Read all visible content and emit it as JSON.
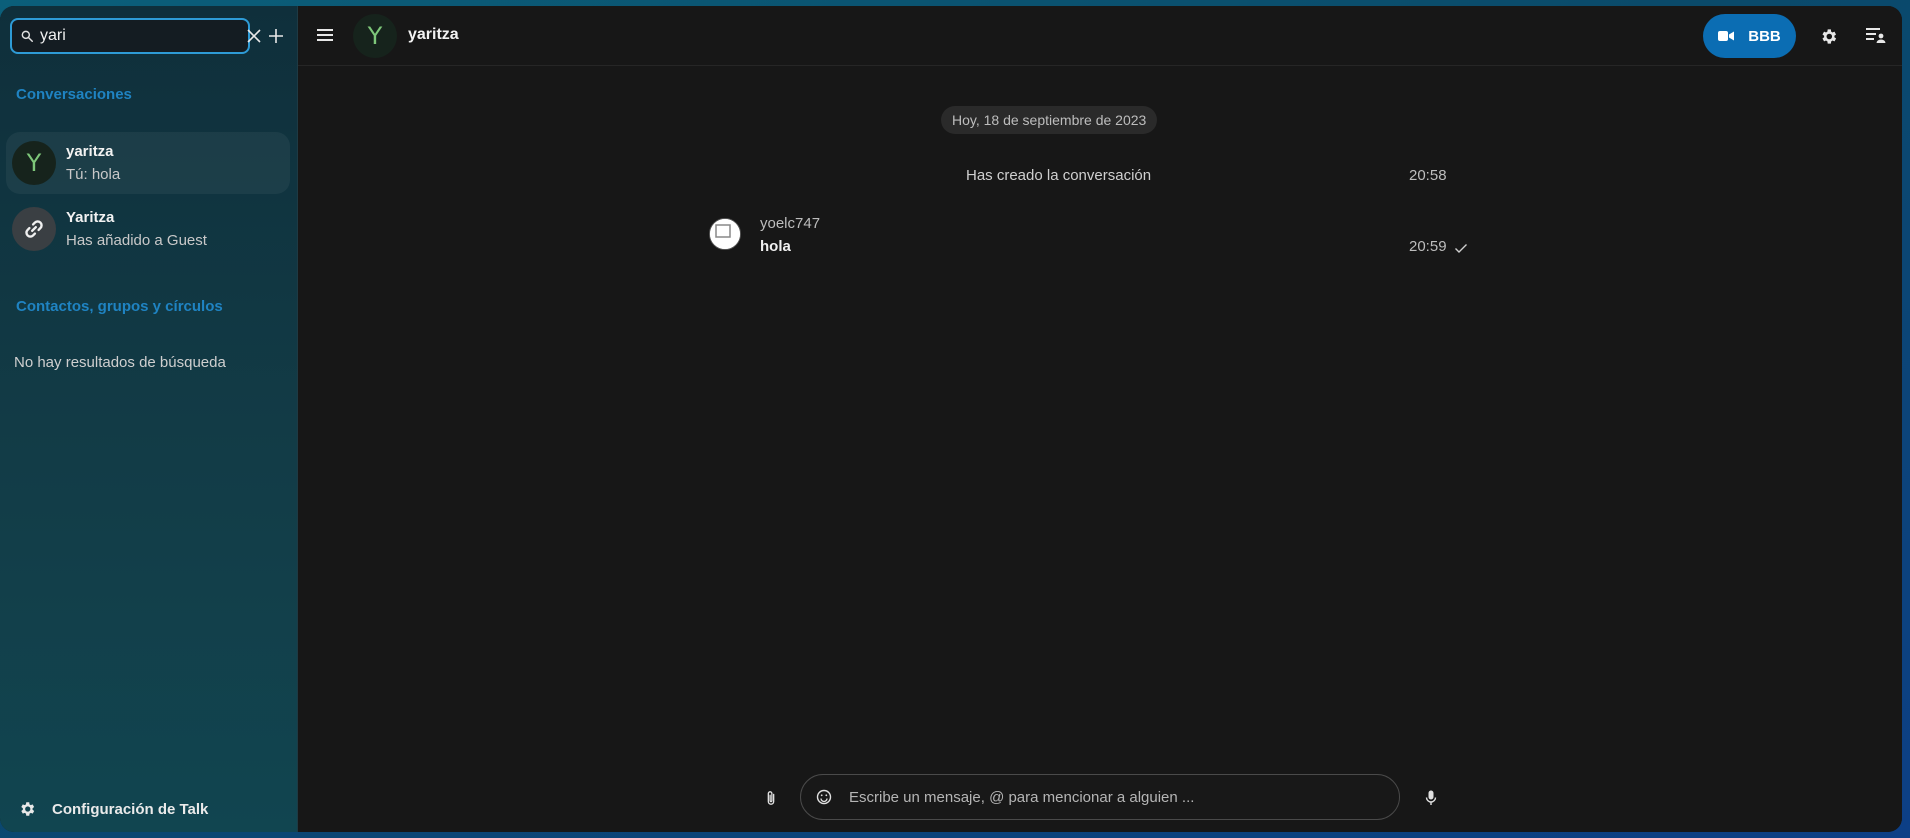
{
  "search": {
    "value": "yari"
  },
  "sidebar": {
    "conversations_title": "Conversaciones",
    "conversations": [
      {
        "avatar_letter": "Y",
        "name": "yaritza",
        "last_message": "Tú: hola"
      },
      {
        "avatar_icon": "link-icon",
        "name": "Yaritza",
        "last_message": "Has añadido a Guest"
      }
    ],
    "contacts_title": "Contactos, grupos y círculos",
    "no_results": "No hay resultados de búsqueda",
    "settings_label": "Configuración de Talk"
  },
  "header": {
    "avatar_letter": "Y",
    "title": "yaritza",
    "call_button_label": "BBB"
  },
  "chat": {
    "date_separator": "Hoy, 18 de septiembre de 2023",
    "system_message": {
      "text": "Has creado la conversación",
      "time": "20:58"
    },
    "messages": [
      {
        "author": "yoelc747",
        "text": "hola",
        "time": "20:59"
      }
    ]
  },
  "composer": {
    "placeholder": "Escribe un mensaje, @ para mencionar a alguien ..."
  },
  "colors": {
    "accent": "#0b6db3",
    "section_title": "#1f83c2",
    "avatar_letter": "#7ec77a"
  }
}
